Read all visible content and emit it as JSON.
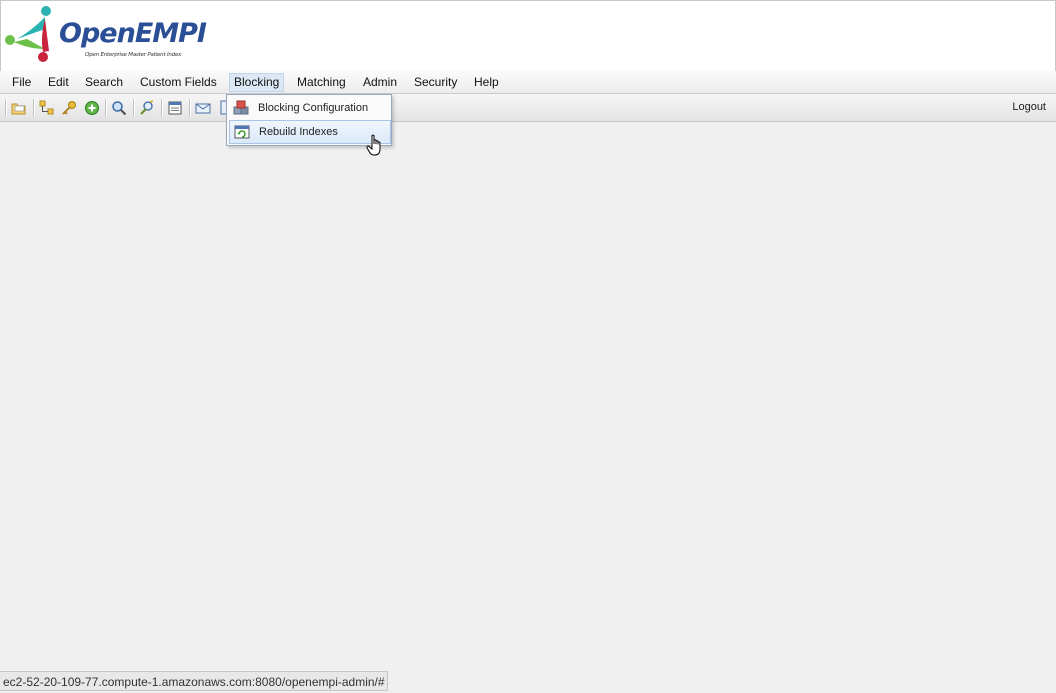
{
  "app": {
    "logo_text_open": "Open",
    "logo_text_empi": "EMPI",
    "logo_tagline": "Open Enterprise Master Patient Index"
  },
  "menubar": {
    "items": [
      {
        "label": "File"
      },
      {
        "label": "Edit"
      },
      {
        "label": "Search"
      },
      {
        "label": "Custom Fields"
      },
      {
        "label": "Blocking"
      },
      {
        "label": "Matching"
      },
      {
        "label": "Admin"
      },
      {
        "label": "Security"
      },
      {
        "label": "Help"
      }
    ],
    "active": "Blocking"
  },
  "toolbar": {
    "logout_label": "Logout",
    "icons": [
      "open-folder-icon",
      "tree-icon",
      "key-icon",
      "add-icon",
      "search-icon",
      "edit-search-icon",
      "report-icon",
      "message-icon",
      "document-icon"
    ]
  },
  "dropdown": {
    "items": [
      {
        "label": "Blocking Configuration",
        "icon": "blocks-icon"
      },
      {
        "label": "Rebuild Indexes",
        "icon": "refresh-window-icon"
      }
    ],
    "hovered": "Rebuild Indexes"
  },
  "statusbar": {
    "url": "ec2-52-20-109-77.compute-1.amazonaws.com:8080/openempi-admin/#"
  },
  "colors": {
    "logo_blue": "#2a4f96",
    "logo_teal": "#2bb3b1",
    "logo_red": "#c8243d",
    "logo_green": "#6cc04a",
    "menu_hover": "#dde8f6"
  }
}
